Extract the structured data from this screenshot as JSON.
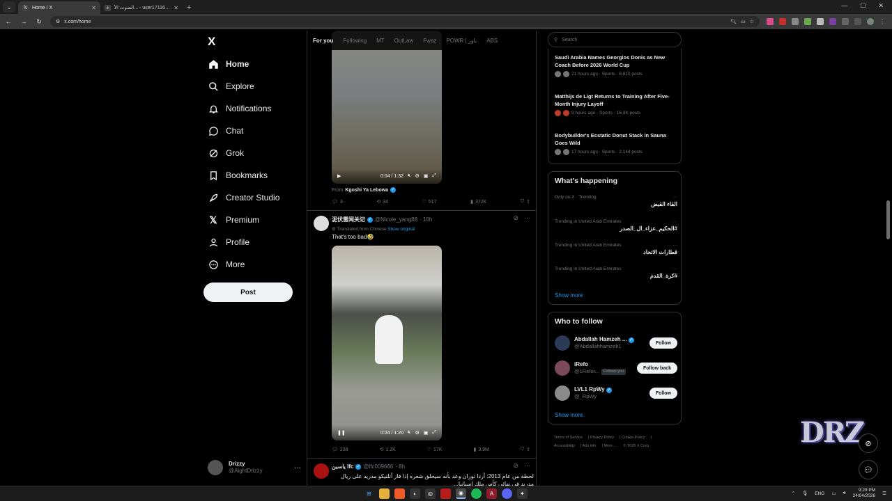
{
  "browser": {
    "tabs": [
      {
        "title": "Home / X",
        "icon": "x-logo-icon",
        "active": true
      },
      {
        "title": "الصوت الأ... - user17116995084",
        "icon": "tiktok-icon",
        "active": false
      }
    ],
    "new_tab": "+",
    "url": "x.com/home"
  },
  "nav": {
    "logo": "X",
    "items": [
      {
        "label": "Home",
        "icon": "home-icon"
      },
      {
        "label": "Explore",
        "icon": "search-icon"
      },
      {
        "label": "Notifications",
        "icon": "bell-icon"
      },
      {
        "label": "Chat",
        "icon": "chat-icon"
      },
      {
        "label": "Grok",
        "icon": "grok-icon"
      },
      {
        "label": "Bookmarks",
        "icon": "bookmark-icon"
      },
      {
        "label": "Creator Studio",
        "icon": "rocket-icon"
      },
      {
        "label": "Premium",
        "icon": "x-premium-icon"
      },
      {
        "label": "Profile",
        "icon": "person-icon"
      },
      {
        "label": "More",
        "icon": "more-circle-icon"
      }
    ],
    "post_button": "Post",
    "account": {
      "name": "Drizzy",
      "handle": "@AightDrizzy",
      "more": "···"
    }
  },
  "feed": {
    "tabs": [
      "For you",
      "Following",
      "MT",
      "OutLaw",
      "Fwaz",
      "POWR | باور",
      "ABS"
    ],
    "post1": {
      "video_time": "0:04 / 1:32",
      "from_label": "From",
      "from_name": "Kgoshi Ya Lebowa",
      "replies": "3",
      "reposts": "34",
      "likes": "517",
      "views": "372K"
    },
    "post2": {
      "name": "泥伏雷闻关记",
      "handle": "@Nicole_yang88",
      "time": "· 10h",
      "translated": "Translated from Chinese",
      "show_original": "Show original",
      "text": "That's too bad🤣",
      "video_time": "0:04 / 1:20",
      "replies": "238",
      "reposts": "1.2K",
      "likes": "17K",
      "views": "3.9M"
    },
    "post3": {
      "name": "ياسين lfc",
      "handle": "@lfc009666",
      "time": "· 8h",
      "text": "لحظة من عام 2013: أردا توران وعد بأنه سيحلق شعره إذا فاز أتلتيكو مدريد على ريال مدريد في نهائي كأس ملك إسبانيا..."
    }
  },
  "right": {
    "search_placeholder": "Search",
    "news": [
      {
        "title": "Saudi Arabia Names Georgios Donis as New Coach Before 2026 World Cup",
        "meta": "21 hours ago · Sports · 8,810 posts"
      },
      {
        "title": "Matthijs de Ligt Returns to Training After Five-Month Injury Layoff",
        "meta": "9 hours ago · Sports · 16.3K posts"
      },
      {
        "title": "Bodybuilder's Ecstatic Donut Stack in Sauna Goes Wild",
        "meta": "17 hours ago · Sports · 2,144 posts"
      }
    ],
    "happening_title": "What's happening",
    "trends": [
      {
        "category": "Only on X · Trending",
        "name": "القاء القبض"
      },
      {
        "category": "Trending in United Arab Emirates",
        "name": "#الحكيم_عزاء_ال_الصدر"
      },
      {
        "category": "Trending in United Arab Emirates",
        "name": "قطارات الاتحاد"
      },
      {
        "category": "Trending in United Arab Emirates",
        "name": "#كرة_القدم"
      }
    ],
    "show_more": "Show more",
    "follow_title": "Who to follow",
    "follow": [
      {
        "name": "Abdallah Hamzeh ...",
        "handle": "@Abdallahhamzeh1",
        "button": "Follow",
        "follows_you": ""
      },
      {
        "name": "iRefo",
        "handle": "@1Refor...",
        "button": "Follow back",
        "follows_you": "Follows you"
      },
      {
        "name": "LVL1 RpWy",
        "handle": "@_RpWy",
        "button": "Follow",
        "follows_you": ""
      }
    ],
    "footer": [
      "Terms of Service",
      "Privacy Policy",
      "Cookie Policy",
      "Accessibility",
      "Ads info",
      "More ...",
      "© 2026 X Corp."
    ]
  },
  "overlay": {
    "logo_text": "DRZ"
  },
  "taskbar": {
    "lang": "ENG",
    "time": "9:29 PM",
    "date": "24/04/2026"
  },
  "colors": {
    "accent": "#1d9bf0",
    "background": "#000000",
    "border": "#2f3336",
    "muted": "#71767b"
  }
}
